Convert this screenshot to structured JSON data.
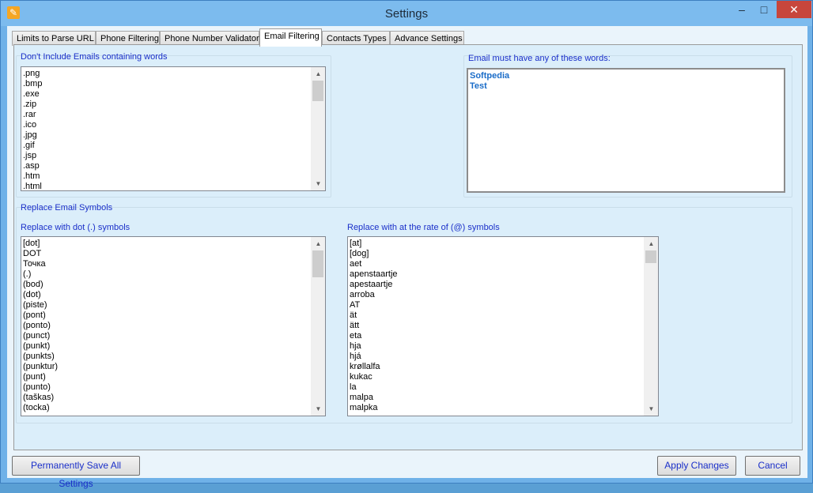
{
  "window": {
    "title": "Settings",
    "icon": "wrench-icon"
  },
  "tabs": [
    {
      "label": "Limits to Parse URL"
    },
    {
      "label": "Phone Filtering"
    },
    {
      "label": "Phone Number Validator"
    },
    {
      "label": "Email Filtering"
    },
    {
      "label": "Contacts Types"
    },
    {
      "label": "Advance Settings"
    }
  ],
  "active_tab": "Email Filtering",
  "exclude_words": {
    "label": "Don't Include Emails containing words",
    "items": [
      ".png",
      ".bmp",
      ".exe",
      ".zip",
      ".rar",
      ".ico",
      ".jpg",
      ".gif",
      ".jsp",
      ".asp",
      ".htm",
      ".html"
    ]
  },
  "required_words": {
    "label": "Email must have any of these words:",
    "items": [
      "Softpedia",
      "Test"
    ]
  },
  "replace_symbols": {
    "label": "Replace Email Symbols",
    "dot": {
      "label": "Replace with dot (.) symbols",
      "items": [
        " [dot]",
        " DOT",
        " Точка",
        "(.)",
        "(bod)",
        "(dot)",
        "(piste)",
        "(pont)",
        "(ponto)",
        "(punct)",
        "(punkt)",
        "(punkts)",
        "(punktur)",
        "(punt)",
        "(punto)",
        "(taškas)",
        "(tocka)"
      ]
    },
    "at": {
      "label": "Replace with at the rate of (@) symbols",
      "items": [
        "[at]",
        "[dog]",
        "aet",
        "apenstaartje",
        "apestaartje",
        "arroba",
        "AT",
        "ät",
        "ätt",
        "eta",
        "hja",
        "hjá",
        "krøllalfa",
        "kukac",
        "la",
        "malpa",
        "malpka"
      ]
    }
  },
  "buttons": {
    "save_all": "Permanently Save All Settings",
    "apply": "Apply Changes",
    "cancel": "Cancel"
  },
  "window_controls": {
    "minimize": "–",
    "maximize": "□",
    "close": "✕"
  }
}
